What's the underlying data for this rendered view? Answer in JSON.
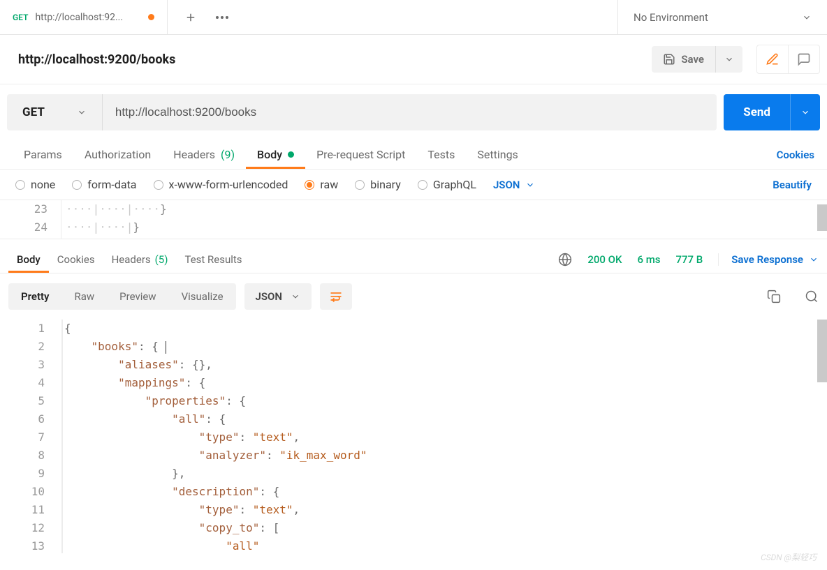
{
  "tab": {
    "method": "GET",
    "title": "http://localhost:92..."
  },
  "environment": {
    "label": "No Environment"
  },
  "request_bar": {
    "name": "http://localhost:9200/books",
    "save": "Save"
  },
  "url_row": {
    "method": "GET",
    "url": "http://localhost:9200/books",
    "send": "Send"
  },
  "req_tabs": {
    "params": "Params",
    "authorization": "Authorization",
    "headers": "Headers",
    "headers_count": "(9)",
    "body": "Body",
    "prescript": "Pre-request Script",
    "tests": "Tests",
    "settings": "Settings",
    "cookies": "Cookies"
  },
  "body_type": {
    "none": "none",
    "formdata": "form-data",
    "xwww": "x-www-form-urlencoded",
    "raw": "raw",
    "binary": "binary",
    "graphql": "GraphQL",
    "lang": "JSON",
    "beautify": "Beautify"
  },
  "req_code": [
    {
      "num": "23",
      "txt": "····|····|····}"
    },
    {
      "num": "24",
      "txt": "····|····|}"
    }
  ],
  "resp_tabs": {
    "body": "Body",
    "cookies": "Cookies",
    "headers": "Headers",
    "headers_count": "(5)",
    "testres": "Test Results"
  },
  "status": {
    "code": "200 OK",
    "time": "6 ms",
    "size": "777 B",
    "save": "Save Response"
  },
  "view": {
    "pretty": "Pretty",
    "raw": "Raw",
    "preview": "Preview",
    "visualize": "Visualize",
    "json": "JSON"
  },
  "resp_lines": [
    {
      "num": "1",
      "ind": 0,
      "k": "",
      "after": "{"
    },
    {
      "num": "2",
      "ind": 1,
      "k": "\"books\"",
      "after": ": {"
    },
    {
      "num": "3",
      "ind": 2,
      "k": "\"aliases\"",
      "after": ": {},"
    },
    {
      "num": "4",
      "ind": 2,
      "k": "\"mappings\"",
      "after": ": {"
    },
    {
      "num": "5",
      "ind": 3,
      "k": "\"properties\"",
      "after": ": {"
    },
    {
      "num": "6",
      "ind": 4,
      "k": "\"all\"",
      "after": ": {"
    },
    {
      "num": "7",
      "ind": 5,
      "k": "\"type\"",
      "after": ": \"text\","
    },
    {
      "num": "8",
      "ind": 5,
      "k": "\"analyzer\"",
      "after": ": \"ik_max_word\""
    },
    {
      "num": "9",
      "ind": 4,
      "k": "",
      "after": "},"
    },
    {
      "num": "10",
      "ind": 4,
      "k": "\"description\"",
      "after": ": {"
    },
    {
      "num": "11",
      "ind": 5,
      "k": "\"type\"",
      "after": ": \"text\","
    },
    {
      "num": "12",
      "ind": 5,
      "k": "\"copy_to\"",
      "after": ": ["
    },
    {
      "num": "13",
      "ind": 6,
      "k": "",
      "after": "\"all\""
    }
  ],
  "watermark": "CSDN @梨轻巧"
}
